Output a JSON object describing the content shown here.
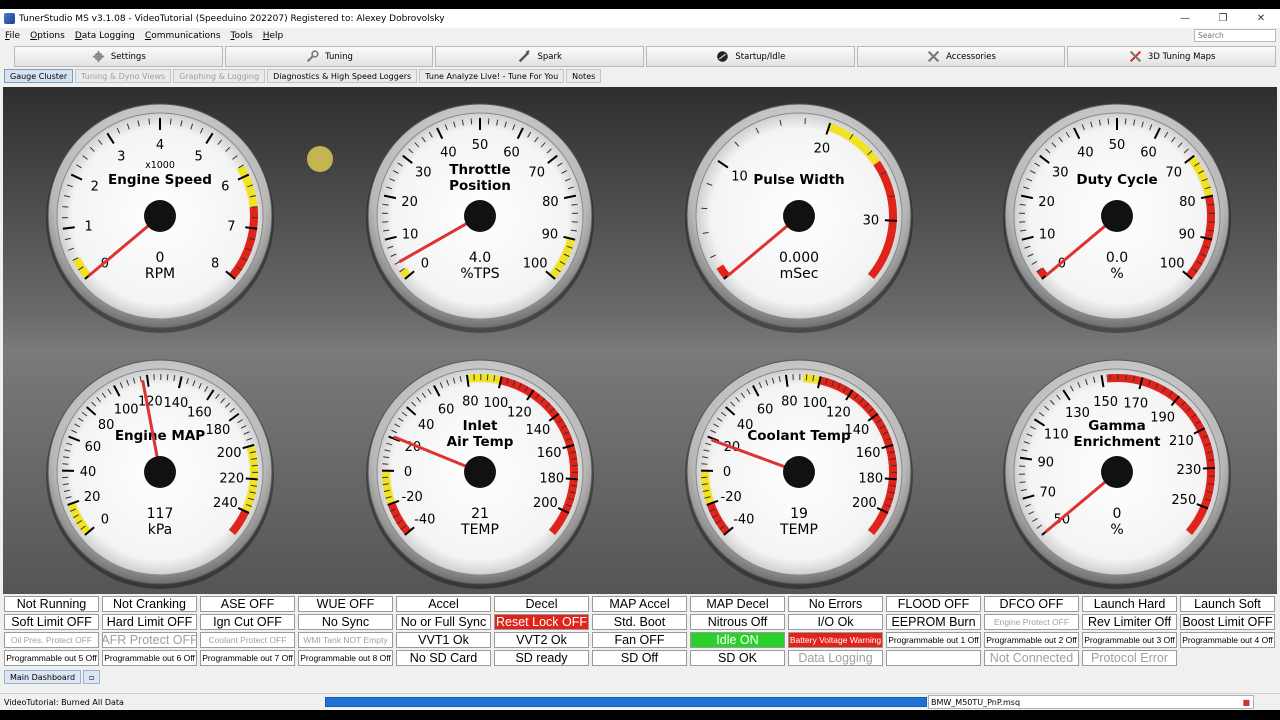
{
  "window": {
    "title": "TunerStudio MS v3.1.08 - VideoTutorial (Speeduino 202207) Registered to: Alexey Dobrovolsky"
  },
  "menu": [
    "File",
    "Options",
    "Data Logging",
    "Communications",
    "Tools",
    "Help"
  ],
  "search": {
    "placeholder": "Search"
  },
  "toolbar": [
    {
      "label": "Settings",
      "icon": "settings-gear-icon"
    },
    {
      "label": "Tuning",
      "icon": "wrench-icon"
    },
    {
      "label": "Spark",
      "icon": "spark-plug-icon"
    },
    {
      "label": "Startup/Idle",
      "icon": "idle-icon"
    },
    {
      "label": "Accessories",
      "icon": "accessories-icon"
    },
    {
      "label": "3D Tuning Maps",
      "icon": "tuning-maps-icon"
    }
  ],
  "tabs": [
    {
      "label": "Gauge Cluster",
      "state": "active"
    },
    {
      "label": "Tuning & Dyno Views",
      "state": "disabled"
    },
    {
      "label": "Graphing & Logging",
      "state": "disabled"
    },
    {
      "label": "Diagnostics & High Speed Loggers",
      "state": "normal"
    },
    {
      "label": "Tune Analyze Live! - Tune For You",
      "state": "normal"
    },
    {
      "label": "Notes",
      "state": "normal"
    }
  ],
  "gauges": [
    {
      "id": "engine-speed",
      "title": "Engine Speed",
      "title2": "",
      "multiplier": "x1000",
      "value": "0",
      "unit": "RPM",
      "min": 0,
      "max": 8,
      "ticks": [
        "0",
        "1",
        "2",
        "3",
        "4",
        "5",
        "6",
        "7",
        "8"
      ],
      "reading": 0,
      "warn": [
        [
          0,
          0.4
        ],
        [
          5.8,
          6.6
        ]
      ],
      "danger": [
        [
          6.6,
          8
        ]
      ]
    },
    {
      "id": "throttle-position",
      "title": "Throttle",
      "title2": "Position",
      "multiplier": "",
      "value": "4.0",
      "unit": "%TPS",
      "min": 0,
      "max": 100,
      "ticks": [
        "0",
        "10",
        "20",
        "30",
        "40",
        "50",
        "60",
        "70",
        "80",
        "90",
        "100"
      ],
      "reading": 4,
      "warn": [
        [
          0,
          2
        ],
        [
          90,
          100
        ]
      ],
      "danger": []
    },
    {
      "id": "pulse-width",
      "title": "Pulse Width",
      "title2": "",
      "multiplier": "",
      "value": "0.000",
      "unit": "mSec",
      "min": 0,
      "max": 35,
      "ticks": [
        "",
        "10",
        "20",
        "30"
      ],
      "reading": 0,
      "warn": [
        [
          20,
          25
        ]
      ],
      "danger": [
        [
          0,
          1
        ],
        [
          25,
          35
        ]
      ]
    },
    {
      "id": "duty-cycle",
      "title": "Duty Cycle",
      "title2": "",
      "multiplier": "",
      "value": "0.0",
      "unit": "%",
      "min": 0,
      "max": 100,
      "ticks": [
        "0",
        "10",
        "20",
        "30",
        "40",
        "50",
        "60",
        "70",
        "80",
        "90",
        "100"
      ],
      "reading": 0,
      "warn": [
        [
          70,
          80
        ]
      ],
      "danger": [
        [
          0,
          2
        ],
        [
          80,
          100
        ]
      ]
    },
    {
      "id": "engine-map",
      "title": "Engine MAP",
      "title2": "",
      "multiplier": "",
      "value": "117",
      "unit": "kPa",
      "min": 0,
      "max": 255,
      "ticks": [
        "0",
        "20",
        "40",
        "60",
        "80",
        "100",
        "120",
        "140",
        "160",
        "180",
        "200",
        "220",
        "240"
      ],
      "reading": 117,
      "warn": [
        [
          0,
          20
        ],
        [
          200,
          240
        ]
      ],
      "danger": [
        [
          240,
          255
        ]
      ]
    },
    {
      "id": "inlet-air-temp",
      "title": "Inlet",
      "title2": "Air Temp",
      "multiplier": "",
      "value": "21",
      "unit": "TEMP",
      "min": -40,
      "max": 215,
      "ticks": [
        "-40",
        "-20",
        "0",
        "20",
        "40",
        "60",
        "80",
        "100",
        "120",
        "140",
        "160",
        "180",
        "200"
      ],
      "reading": 21,
      "warn": [
        [
          -20,
          0
        ],
        [
          80,
          100
        ]
      ],
      "danger": [
        [
          -40,
          -20
        ],
        [
          100,
          215
        ]
      ]
    },
    {
      "id": "coolant-temp",
      "title": "Coolant Temp",
      "title2": "",
      "multiplier": "",
      "value": "19",
      "unit": "TEMP",
      "min": -40,
      "max": 215,
      "ticks": [
        "-40",
        "-20",
        "0",
        "20",
        "40",
        "60",
        "80",
        "100",
        "120",
        "140",
        "160",
        "180",
        "200"
      ],
      "reading": 19,
      "warn": [
        [
          -20,
          0
        ],
        [
          90,
          100
        ]
      ],
      "danger": [
        [
          -40,
          -20
        ],
        [
          100,
          215
        ]
      ]
    },
    {
      "id": "gamma-enrichment",
      "title": "Gamma",
      "title2": "Enrichment",
      "multiplier": "",
      "value": "0",
      "unit": "%",
      "min": 50,
      "max": 260,
      "ticks": [
        "50",
        "70",
        "90",
        "110",
        "130",
        "150",
        "170",
        "190",
        "210",
        "230",
        "250"
      ],
      "reading": 0,
      "warn": [],
      "danger": [
        [
          150,
          260
        ]
      ]
    }
  ],
  "indicators": [
    [
      {
        "t": "Not Running"
      },
      {
        "t": "Not Cranking"
      },
      {
        "t": "ASE OFF"
      },
      {
        "t": "WUE OFF"
      },
      {
        "t": "Accel"
      },
      {
        "t": "Decel"
      },
      {
        "t": "MAP Accel"
      },
      {
        "t": "MAP Decel"
      },
      {
        "t": "No Errors"
      },
      {
        "t": "FLOOD OFF"
      },
      {
        "t": "DFCO OFF"
      },
      {
        "t": "Launch Hard"
      },
      {
        "t": "Launch Soft"
      }
    ],
    [
      {
        "t": "Soft Limit OFF"
      },
      {
        "t": "Hard Limit OFF"
      },
      {
        "t": "Ign Cut OFF"
      },
      {
        "t": "No Sync"
      },
      {
        "t": "No or Full Sync"
      },
      {
        "t": "Reset Lock OFF",
        "s": "red"
      },
      {
        "t": "Std. Boot"
      },
      {
        "t": "Nitrous Off"
      },
      {
        "t": "I/O Ok"
      },
      {
        "t": "EEPROM Burn"
      },
      {
        "t": "Engine Protect OFF",
        "s": "small dim"
      },
      {
        "t": "Rev Limiter Off"
      },
      {
        "t": "Boost Limit OFF"
      }
    ],
    [
      {
        "t": "Oil Pres. Protect OFF",
        "s": "small dim"
      },
      {
        "t": "AFR Protect OFF",
        "s": "dim"
      },
      {
        "t": "Coolant Protect OFF",
        "s": "small dim"
      },
      {
        "t": "WMI Tank NOT Empty",
        "s": "small dim"
      },
      {
        "t": "VVT1 Ok"
      },
      {
        "t": "VVT2 Ok"
      },
      {
        "t": "Fan OFF"
      },
      {
        "t": "Idle ON",
        "s": "green"
      },
      {
        "t": "Battery Voltage Warning",
        "s": "red small"
      },
      {
        "t": "Programmable out 1 Off",
        "s": "small"
      },
      {
        "t": "Programmable out 2 Off",
        "s": "small"
      },
      {
        "t": "Programmable out 3 Off",
        "s": "small"
      },
      {
        "t": "Programmable out 4 Off",
        "s": "small"
      }
    ],
    [
      {
        "t": "Programmable out 5 Off",
        "s": "small"
      },
      {
        "t": "Programmable out 6 Off",
        "s": "small"
      },
      {
        "t": "Programmable out 7 Off",
        "s": "small"
      },
      {
        "t": "Programmable out 8 Off",
        "s": "small"
      },
      {
        "t": "No SD Card"
      },
      {
        "t": "SD ready"
      },
      {
        "t": "SD Off"
      },
      {
        "t": "SD OK"
      },
      {
        "t": "Data Logging",
        "s": "dim"
      },
      {
        "t": ""
      },
      {
        "t": "Not Connected",
        "s": "dim"
      },
      {
        "t": "Protocol Error",
        "s": "dim"
      }
    ]
  ],
  "bottom_tabs": [
    {
      "label": "Main Dashboard"
    }
  ],
  "status": {
    "message": "VideoTutorial: Burned All Data",
    "progress": 1.0,
    "project_file": "BMW_M50TU_PnP.msq"
  },
  "colors": {
    "red": "#e0241b",
    "yellow": "#f2e224",
    "green": "#2ad12a",
    "progress": "#1e72d6"
  }
}
